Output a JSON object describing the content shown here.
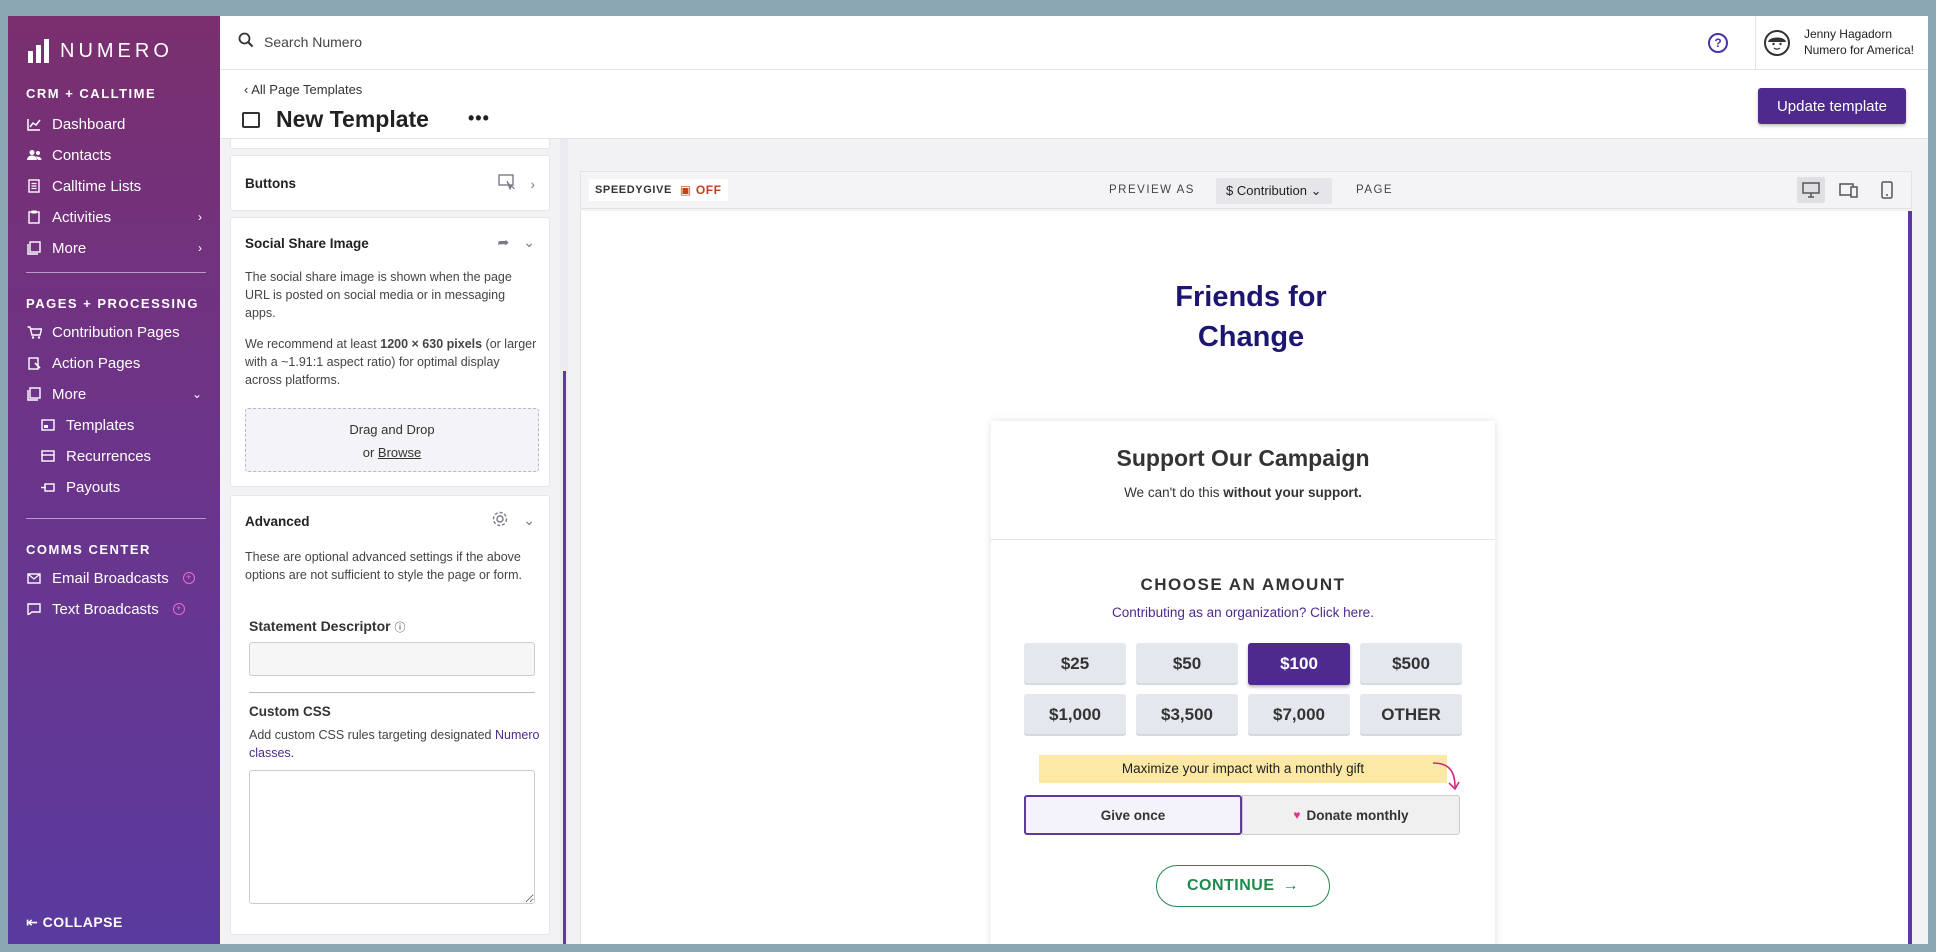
{
  "app": {
    "logo_text": "NUMERO"
  },
  "sidebar": {
    "sections": [
      {
        "title": "CRM + CALLTIME"
      },
      {
        "title": "PAGES + PROCESSING"
      },
      {
        "title": "COMMS CENTER"
      }
    ],
    "crm": [
      {
        "label": "Dashboard"
      },
      {
        "label": "Contacts"
      },
      {
        "label": "Calltime Lists"
      },
      {
        "label": "Activities"
      },
      {
        "label": "More"
      }
    ],
    "pages": [
      {
        "label": "Contribution Pages"
      },
      {
        "label": "Action Pages"
      },
      {
        "label": "More"
      },
      {
        "label": "Templates"
      },
      {
        "label": "Recurrences"
      },
      {
        "label": "Payouts"
      }
    ],
    "comms": [
      {
        "label": "Email Broadcasts"
      },
      {
        "label": "Text Broadcasts"
      }
    ],
    "collapse_label": "COLLAPSE"
  },
  "topbar": {
    "search_placeholder": "Search Numero",
    "user_name": "Jenny Hagadorn",
    "user_org": "Numero for America!"
  },
  "header": {
    "breadcrumb": "All Page Templates",
    "title": "New Template",
    "update_button": "Update template"
  },
  "panel": {
    "buttons_card": {
      "title": "Buttons"
    },
    "social": {
      "title": "Social Share Image",
      "desc1": "The social share image is shown when the page URL is posted on social media or in messaging apps.",
      "desc2_prefix": "We recommend at least ",
      "desc2_bold": "1200 × 630 pixels",
      "desc2_suffix": " (or larger with a ~1.91:1 aspect ratio) for optimal display across platforms.",
      "drop_text": "Drag and Drop",
      "drop_or": "or",
      "drop_browse": "Browse"
    },
    "advanced": {
      "title": "Advanced",
      "desc": "These are optional advanced settings if the above options are not sufficient to style the page or form.",
      "statement_label": "Statement Descriptor",
      "statement_value": "",
      "css_label": "Custom CSS",
      "css_desc": "Add custom CSS rules targeting designated",
      "css_link": "Numero classes.",
      "css_value": ""
    }
  },
  "preview": {
    "speedygive_label": "SPEEDYGIVE",
    "speedygive_state": "OFF",
    "preview_as": "PREVIEW AS",
    "page_type": "Contribution",
    "page_label": "PAGE",
    "org_name": "Friends for Change",
    "form": {
      "title": "Support Our Campaign",
      "sub_prefix": "We can't do this ",
      "sub_bold": "without your support.",
      "choose": "CHOOSE AN AMOUNT",
      "org_link": "Contributing as an organization? Click here.",
      "amounts": [
        "$25",
        "$50",
        "$100",
        "$500",
        "$1,000",
        "$3,500",
        "$7,000",
        "OTHER"
      ],
      "selected_amount": "$100",
      "monthly_note": "Maximize your impact with a monthly gift",
      "give_once": "Give once",
      "donate_monthly": "Donate monthly",
      "continue": "CONTINUE"
    }
  },
  "colors": {
    "brand_purple": "#4e2a8e",
    "org_title": "#1c1670",
    "continue_green": "#1e8a4d",
    "speedygive_off": "#c0421a"
  }
}
